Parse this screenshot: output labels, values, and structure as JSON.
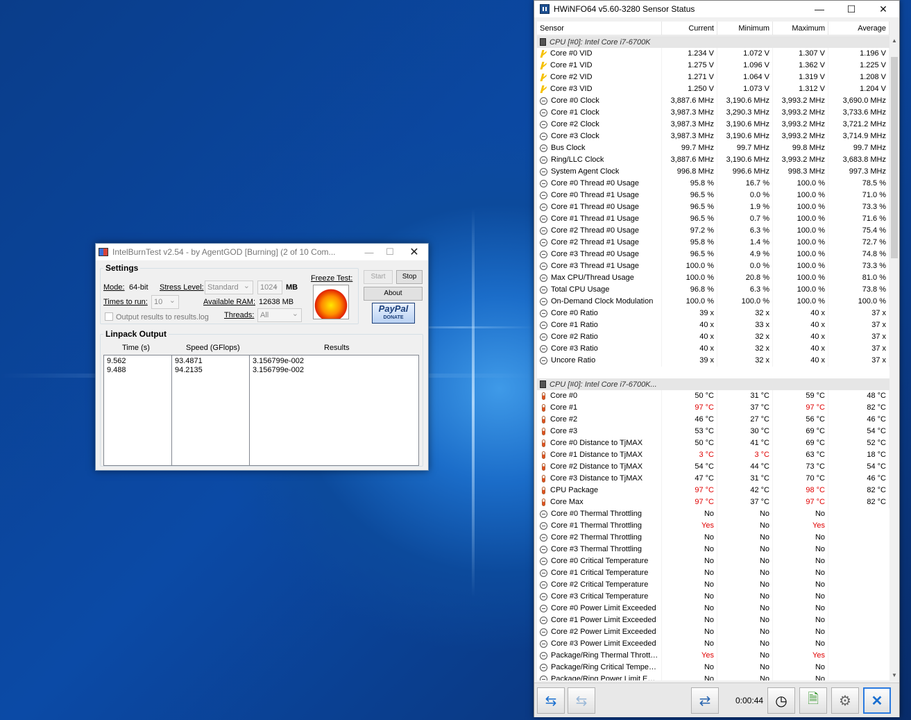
{
  "hwinfo": {
    "title": "HWiNFO64 v5.60-3280 Sensor Status",
    "columns": [
      "Sensor",
      "Current",
      "Minimum",
      "Maximum",
      "Average"
    ],
    "groups": [
      {
        "label": "CPU [#0]: Intel Core i7-6700K",
        "rows": [
          [
            "volt",
            "Core #0 VID",
            "1.234 V",
            "1.072 V",
            "1.307 V",
            "1.196 V"
          ],
          [
            "volt",
            "Core #1 VID",
            "1.275 V",
            "1.096 V",
            "1.362 V",
            "1.225 V"
          ],
          [
            "volt",
            "Core #2 VID",
            "1.271 V",
            "1.064 V",
            "1.319 V",
            "1.208 V"
          ],
          [
            "volt",
            "Core #3 VID",
            "1.250 V",
            "1.073 V",
            "1.312 V",
            "1.204 V"
          ],
          [
            "clock",
            "Core #0 Clock",
            "3,887.6 MHz",
            "3,190.6 MHz",
            "3,993.2 MHz",
            "3,690.0 MHz"
          ],
          [
            "clock",
            "Core #1 Clock",
            "3,987.3 MHz",
            "3,290.3 MHz",
            "3,993.2 MHz",
            "3,733.6 MHz"
          ],
          [
            "clock",
            "Core #2 Clock",
            "3,987.3 MHz",
            "3,190.6 MHz",
            "3,993.2 MHz",
            "3,721.2 MHz"
          ],
          [
            "clock",
            "Core #3 Clock",
            "3,987.3 MHz",
            "3,190.6 MHz",
            "3,993.2 MHz",
            "3,714.9 MHz"
          ],
          [
            "clock",
            "Bus Clock",
            "99.7 MHz",
            "99.7 MHz",
            "99.8 MHz",
            "99.7 MHz"
          ],
          [
            "clock",
            "Ring/LLC Clock",
            "3,887.6 MHz",
            "3,190.6 MHz",
            "3,993.2 MHz",
            "3,683.8 MHz"
          ],
          [
            "clock",
            "System Agent Clock",
            "996.8 MHz",
            "996.6 MHz",
            "998.3 MHz",
            "997.3 MHz"
          ],
          [
            "clock",
            "Core #0 Thread #0 Usage",
            "95.8 %",
            "16.7 %",
            "100.0 %",
            "78.5 %"
          ],
          [
            "clock",
            "Core #0 Thread #1 Usage",
            "96.5 %",
            "0.0 %",
            "100.0 %",
            "71.0 %"
          ],
          [
            "clock",
            "Core #1 Thread #0 Usage",
            "96.5 %",
            "1.9 %",
            "100.0 %",
            "73.3 %"
          ],
          [
            "clock",
            "Core #1 Thread #1 Usage",
            "96.5 %",
            "0.7 %",
            "100.0 %",
            "71.6 %"
          ],
          [
            "clock",
            "Core #2 Thread #0 Usage",
            "97.2 %",
            "6.3 %",
            "100.0 %",
            "75.4 %"
          ],
          [
            "clock",
            "Core #2 Thread #1 Usage",
            "95.8 %",
            "1.4 %",
            "100.0 %",
            "72.7 %"
          ],
          [
            "clock",
            "Core #3 Thread #0 Usage",
            "96.5 %",
            "4.9 %",
            "100.0 %",
            "74.8 %"
          ],
          [
            "clock",
            "Core #3 Thread #1 Usage",
            "100.0 %",
            "0.0 %",
            "100.0 %",
            "73.3 %"
          ],
          [
            "clock",
            "Max CPU/Thread Usage",
            "100.0 %",
            "20.8 %",
            "100.0 %",
            "81.0 %"
          ],
          [
            "clock",
            "Total CPU Usage",
            "96.8 %",
            "6.3 %",
            "100.0 %",
            "73.8 %"
          ],
          [
            "clock",
            "On-Demand Clock Modulation",
            "100.0 %",
            "100.0 %",
            "100.0 %",
            "100.0 %"
          ],
          [
            "clock",
            "Core #0 Ratio",
            "39 x",
            "32 x",
            "40 x",
            "37 x"
          ],
          [
            "clock",
            "Core #1 Ratio",
            "40 x",
            "33 x",
            "40 x",
            "37 x"
          ],
          [
            "clock",
            "Core #2 Ratio",
            "40 x",
            "32 x",
            "40 x",
            "37 x"
          ],
          [
            "clock",
            "Core #3 Ratio",
            "40 x",
            "32 x",
            "40 x",
            "37 x"
          ],
          [
            "clock",
            "Uncore Ratio",
            "39 x",
            "32 x",
            "40 x",
            "37 x"
          ]
        ]
      },
      {
        "label": "CPU [#0]: Intel Core i7-6700K...",
        "rows": [
          [
            "temp",
            "Core #0",
            "50 °C",
            "31 °C",
            "59 °C",
            "48 °C"
          ],
          [
            "temp",
            "Core #1",
            "97 °C",
            "37 °C",
            "97 °C",
            "82 °C",
            "r1",
            "r3"
          ],
          [
            "temp",
            "Core #2",
            "46 °C",
            "27 °C",
            "56 °C",
            "46 °C"
          ],
          [
            "temp",
            "Core #3",
            "53 °C",
            "30 °C",
            "69 °C",
            "54 °C"
          ],
          [
            "temp",
            "Core #0 Distance to TjMAX",
            "50 °C",
            "41 °C",
            "69 °C",
            "52 °C"
          ],
          [
            "temp",
            "Core #1 Distance to TjMAX",
            "3 °C",
            "3 °C",
            "63 °C",
            "18 °C",
            "r1",
            "r2"
          ],
          [
            "temp",
            "Core #2 Distance to TjMAX",
            "54 °C",
            "44 °C",
            "73 °C",
            "54 °C"
          ],
          [
            "temp",
            "Core #3 Distance to TjMAX",
            "47 °C",
            "31 °C",
            "70 °C",
            "46 °C"
          ],
          [
            "temp",
            "CPU Package",
            "97 °C",
            "42 °C",
            "98 °C",
            "82 °C",
            "r1",
            "r3"
          ],
          [
            "temp",
            "Core Max",
            "97 °C",
            "37 °C",
            "97 °C",
            "82 °C",
            "r1",
            "r3"
          ],
          [
            "clock",
            "Core #0 Thermal Throttling",
            "No",
            "No",
            "No",
            ""
          ],
          [
            "clock",
            "Core #1 Thermal Throttling",
            "Yes",
            "No",
            "Yes",
            "",
            "r1",
            "r3"
          ],
          [
            "clock",
            "Core #2 Thermal Throttling",
            "No",
            "No",
            "No",
            ""
          ],
          [
            "clock",
            "Core #3 Thermal Throttling",
            "No",
            "No",
            "No",
            ""
          ],
          [
            "clock",
            "Core #0 Critical Temperature",
            "No",
            "No",
            "No",
            ""
          ],
          [
            "clock",
            "Core #1 Critical Temperature",
            "No",
            "No",
            "No",
            ""
          ],
          [
            "clock",
            "Core #2 Critical Temperature",
            "No",
            "No",
            "No",
            ""
          ],
          [
            "clock",
            "Core #3 Critical Temperature",
            "No",
            "No",
            "No",
            ""
          ],
          [
            "clock",
            "Core #0 Power Limit Exceeded",
            "No",
            "No",
            "No",
            ""
          ],
          [
            "clock",
            "Core #1 Power Limit Exceeded",
            "No",
            "No",
            "No",
            ""
          ],
          [
            "clock",
            "Core #2 Power Limit Exceeded",
            "No",
            "No",
            "No",
            ""
          ],
          [
            "clock",
            "Core #3 Power Limit Exceeded",
            "No",
            "No",
            "No",
            ""
          ],
          [
            "clock",
            "Package/Ring Thermal Throttling",
            "Yes",
            "No",
            "Yes",
            "",
            "r1",
            "r3"
          ],
          [
            "clock",
            "Package/Ring Critical Tempera...",
            "No",
            "No",
            "No",
            ""
          ],
          [
            "clock",
            "Package/Ring Power Limit Exc...",
            "No",
            "No",
            "No",
            ""
          ]
        ]
      }
    ],
    "timer": "0:00:44"
  },
  "ibt": {
    "title": "IntelBurnTest v2.54 - by AgentGOD [Burning] (2 of 10 Com...",
    "settings_legend": "Settings",
    "mode_label": "Mode:",
    "mode_value": "64-bit",
    "stress_label": "Stress Level:",
    "stress_value": "Standard",
    "mb_value": "1024",
    "mb_label": "MB",
    "times_label": "Times to run:",
    "times_value": "10",
    "ram_label": "Available RAM:",
    "ram_value": "12638 MB",
    "threads_label": "Threads:",
    "threads_value": "All",
    "output_checkbox": "Output results to results.log",
    "freeze_label": "Freeze Test:",
    "start": "Start",
    "stop": "Stop",
    "about": "About",
    "paypal": "PayPal",
    "donate": "DONATE",
    "linpack_legend": "Linpack Output",
    "out_headers": [
      "Time (s)",
      "Speed (GFlops)",
      "Results"
    ],
    "out_rows": [
      [
        "9.562",
        "93.4871",
        "3.156799e-002"
      ],
      [
        "9.488",
        "94.2135",
        "3.156799e-002"
      ]
    ]
  }
}
